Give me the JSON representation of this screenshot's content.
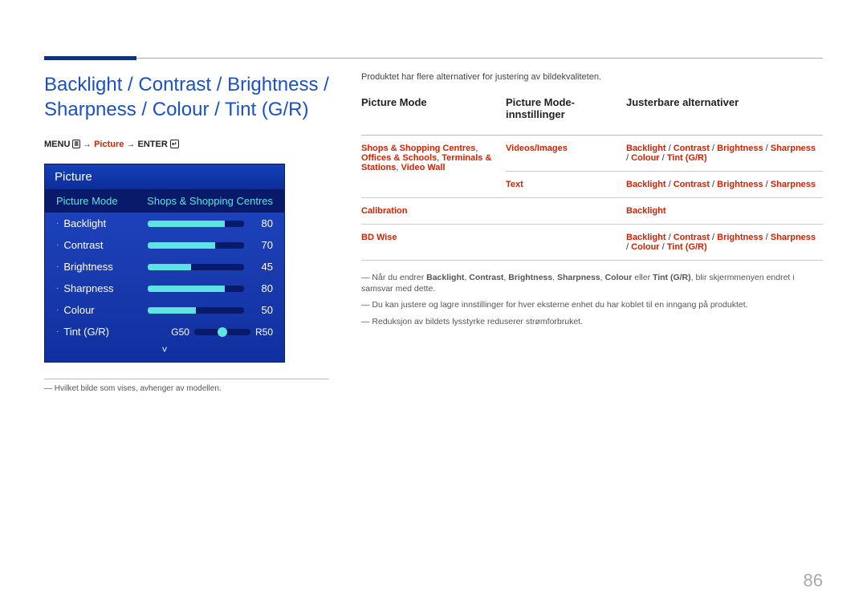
{
  "section_title": "Backlight / Contrast / Brightness / Sharpness / Colour / Tint (G/R)",
  "menu_path": {
    "menu": "MENU",
    "menu_icon": "Ⅲ",
    "arrow": "→",
    "picture": "Picture",
    "enter": "ENTER",
    "enter_icon": "↵"
  },
  "osd": {
    "title": "Picture",
    "mode_label": "Picture Mode",
    "mode_value": "Shops & Shopping Centres",
    "items": [
      {
        "label": "Backlight",
        "value": 80
      },
      {
        "label": "Contrast",
        "value": 70
      },
      {
        "label": "Brightness",
        "value": 45
      },
      {
        "label": "Sharpness",
        "value": 80
      },
      {
        "label": "Colour",
        "value": 50
      }
    ],
    "tint": {
      "label": "Tint (G/R)",
      "g": "G50",
      "r": "R50"
    },
    "chevron": "˅"
  },
  "footnote_osd": "― Hvilket bilde som vises, avhenger av modellen.",
  "intro": "Produktet har flere alternativer for justering av bildekvaliteten.",
  "headers": {
    "h1": "Picture Mode",
    "h2": "Picture Mode-innstillinger",
    "h3": "Justerbare alternativer"
  },
  "rows": [
    {
      "c1": "Shops & Shopping Centres, Offices & Schools,  Terminals & Stations, Video Wall",
      "c2": "Videos/Images",
      "c3": "Backlight / Contrast / Brightness / Sharpness / Colour / Tint (G/R)"
    },
    {
      "c1": "",
      "c2": "Text",
      "c3": "Backlight / Contrast / Brightness / Sharpness"
    },
    {
      "c1": "Calibration",
      "c2": "",
      "c3": "Backlight"
    },
    {
      "c1": "BD Wise",
      "c2": "",
      "c3": "Backlight / Contrast / Brightness / Sharpness / Colour / Tint (G/R)"
    }
  ],
  "notes": [
    "Når du endrer Backlight, Contrast, Brightness, Sharpness, Colour eller Tint (G/R), blir skjermmenyen endret i samsvar med dette.",
    "Du kan justere og lagre innstillinger for hver eksterne enhet du har koblet til en inngang på produktet.",
    "Reduksjon av bildets lysstyrke reduserer strømforbruket."
  ],
  "note_bold_terms": [
    "Backlight",
    "Contrast",
    "Brightness",
    "Sharpness",
    "Colour",
    "Tint (G/R)"
  ],
  "page_number": "86"
}
